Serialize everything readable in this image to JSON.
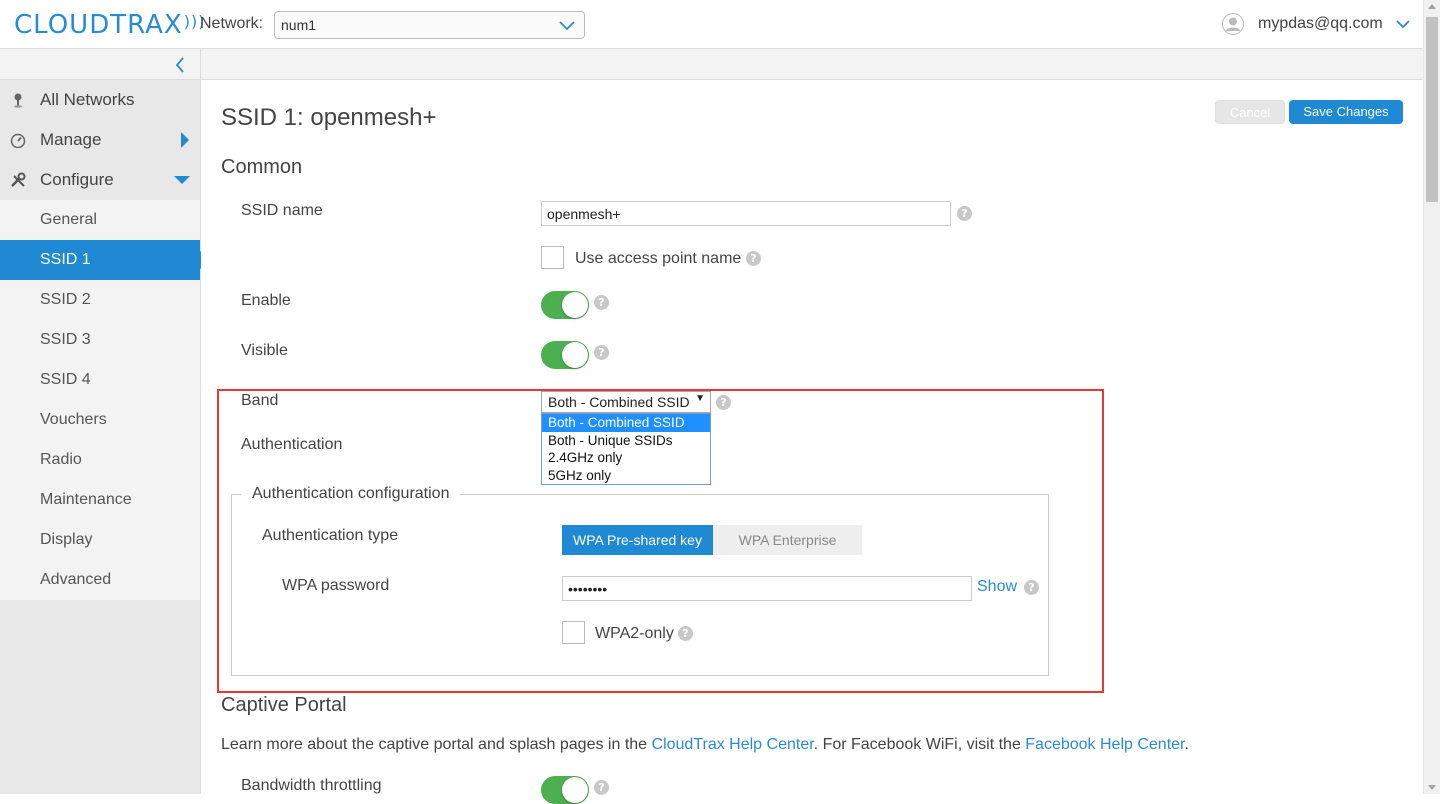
{
  "header": {
    "logo_text": "CLOUDTRAX",
    "network_label": "Network:",
    "network_value": "num1",
    "user_email": "mypdas@qq.com"
  },
  "sidebar": {
    "all_networks": "All Networks",
    "manage": "Manage",
    "configure": "Configure",
    "sub_items": [
      "General",
      "SSID 1",
      "SSID 2",
      "SSID 3",
      "SSID 4",
      "Vouchers",
      "Radio",
      "Maintenance",
      "Display",
      "Advanced"
    ],
    "active_sub_item": "SSID 1"
  },
  "page": {
    "title": "SSID 1: openmesh+",
    "cancel_label": "Cancel",
    "save_label": "Save Changes"
  },
  "common": {
    "heading": "Common",
    "ssid_name_label": "SSID name",
    "ssid_name_value": "openmesh+",
    "use_ap_name_label": "Use access point name",
    "use_ap_name_checked": false,
    "enable_label": "Enable",
    "enable_on": true,
    "visible_label": "Visible",
    "visible_on": true,
    "band_label": "Band",
    "band_value": "Both - Combined SSID",
    "band_options": [
      "Both - Combined SSID",
      "Both - Unique SSIDs",
      "2.4GHz only",
      "5GHz only"
    ],
    "authentication_label": "Authentication"
  },
  "auth_config": {
    "legend": "Authentication configuration",
    "type_label": "Authentication type",
    "type_options": [
      "WPA Pre-shared key",
      "WPA Enterprise"
    ],
    "type_selected": "WPA Pre-shared key",
    "password_label": "WPA password",
    "password_value": "••••••••",
    "show_label": "Show",
    "wpa2_only_label": "WPA2-only",
    "wpa2_only_checked": false
  },
  "captive_portal": {
    "heading": "Captive Portal",
    "text_before": "Learn more about the captive portal and splash pages in the ",
    "link1": "CloudTrax Help Center",
    "text_middle": ". For Facebook WiFi, visit the ",
    "link2": "Facebook Help Center",
    "text_after": ".",
    "bandwidth_label": "Bandwidth throttling"
  },
  "help_glyph": "?",
  "colors": {
    "accent": "#1f8ad3",
    "toggle_on": "#4caf50",
    "highlight_box": "#e53935"
  }
}
